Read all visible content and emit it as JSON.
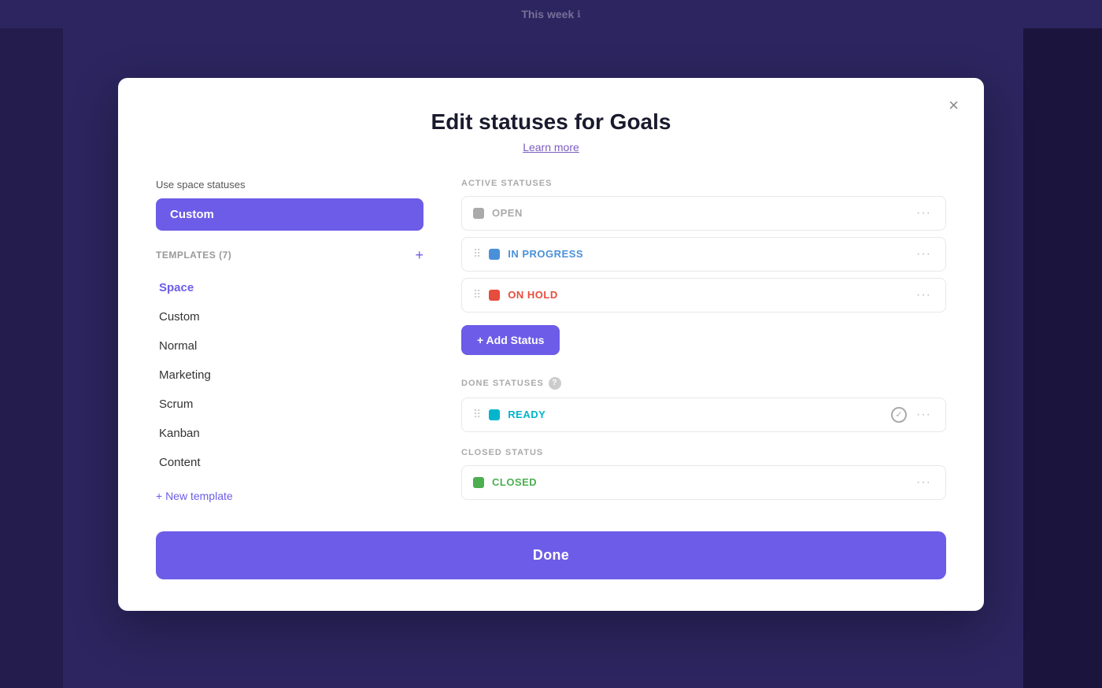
{
  "topBar": {
    "title": "This week",
    "infoIcon": "info-icon"
  },
  "modal": {
    "title": "Edit statuses for Goals",
    "subtitle": "Learn more",
    "closeLabel": "×",
    "leftPanel": {
      "useSpaceLabel": "Use space statuses",
      "selectedOption": "Custom",
      "templatesLabel": "TEMPLATES (7)",
      "addIcon": "+",
      "templates": [
        {
          "label": "Space",
          "active": true
        },
        {
          "label": "Custom",
          "active": false
        },
        {
          "label": "Normal",
          "active": false
        },
        {
          "label": "Marketing",
          "active": false
        },
        {
          "label": "Scrum",
          "active": false
        },
        {
          "label": "Kanban",
          "active": false
        },
        {
          "label": "Content",
          "active": false
        }
      ],
      "newTemplateLabel": "+ New template"
    },
    "rightPanel": {
      "activeSectionLabel": "ACTIVE STATUSES",
      "activeStatuses": [
        {
          "name": "OPEN",
          "colorClass": "gray",
          "hasDragHandle": false
        },
        {
          "name": "IN PROGRESS",
          "colorClass": "blue",
          "hasDragHandle": true
        },
        {
          "name": "ON HOLD",
          "colorClass": "red",
          "hasDragHandle": true
        }
      ],
      "addStatusLabel": "+ Add Status",
      "doneSectionLabel": "DONE STATUSES",
      "helpIcon": "?",
      "doneStatuses": [
        {
          "name": "READY",
          "colorClass": "teal",
          "hasCheck": true
        }
      ],
      "closedSectionLabel": "CLOSED STATUS",
      "closedStatuses": [
        {
          "name": "CLOSED",
          "colorClass": "green",
          "hasCheck": false
        }
      ]
    },
    "doneButtonLabel": "Done"
  }
}
